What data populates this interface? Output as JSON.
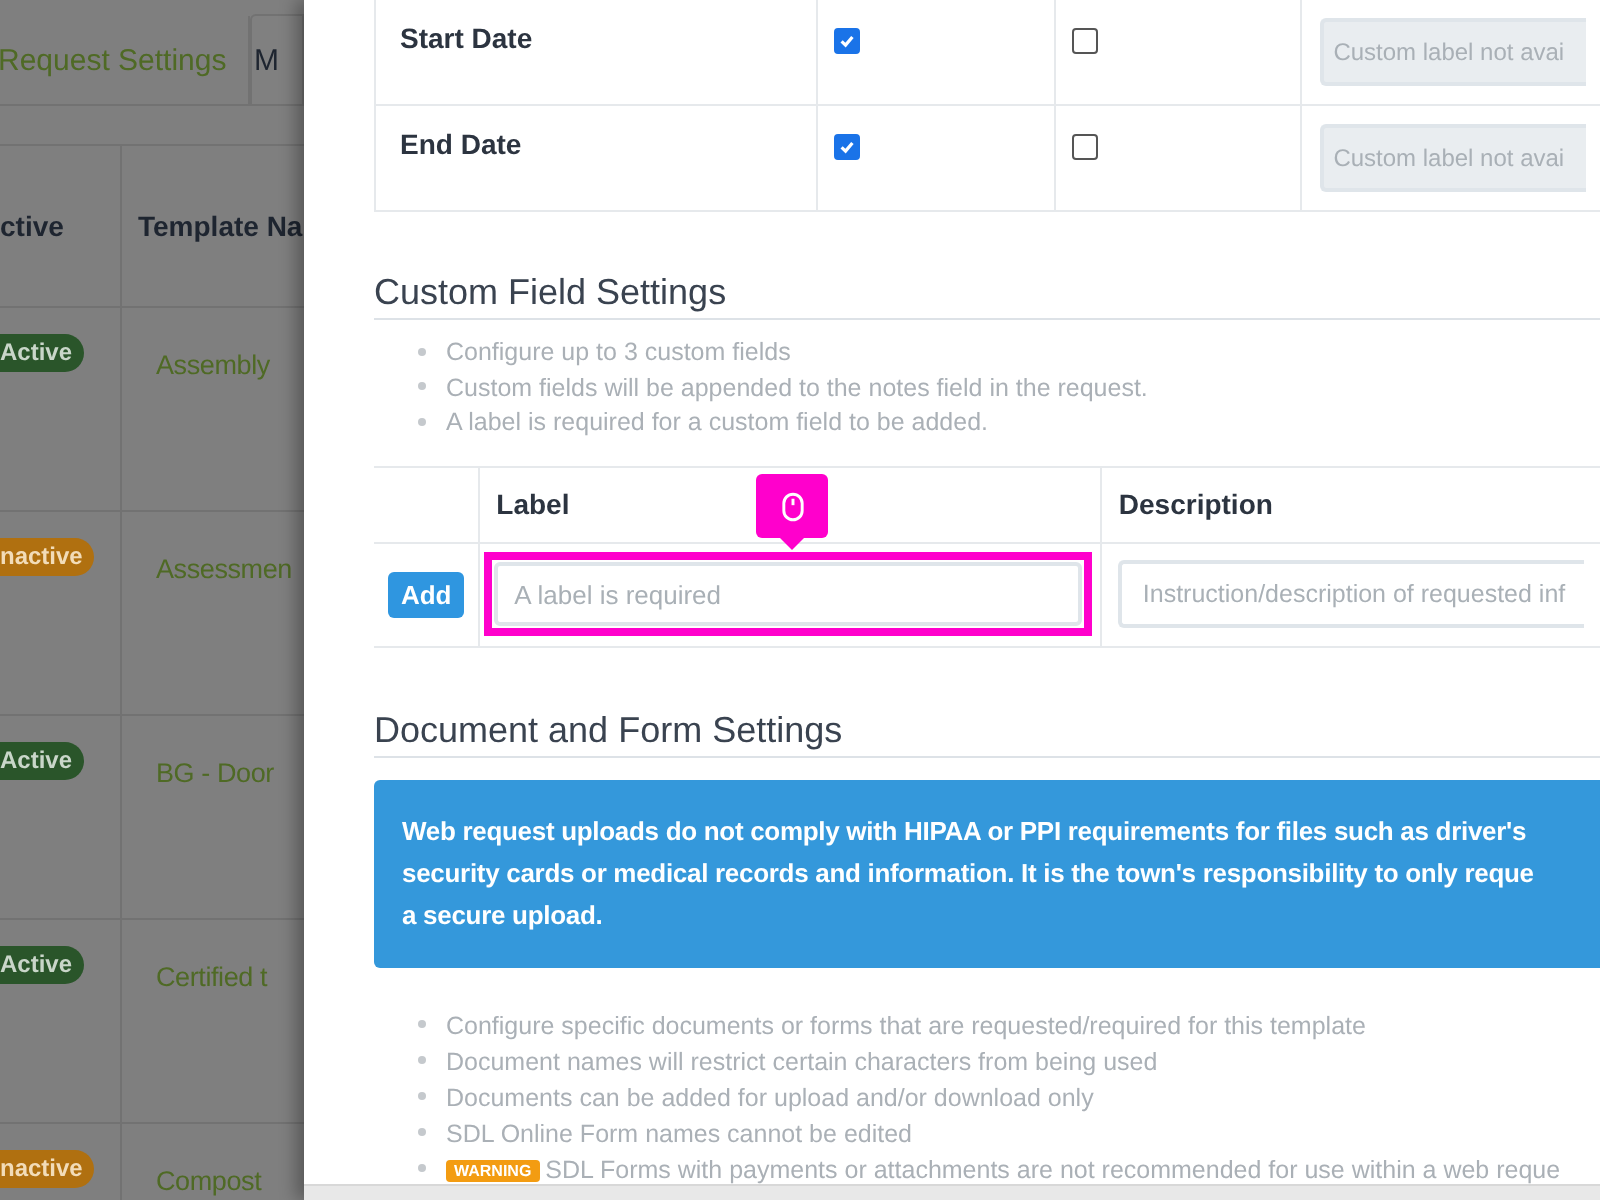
{
  "background_page": {
    "tabs": [
      {
        "label": "Request Settings",
        "selected": false
      },
      {
        "label": "M",
        "selected": true
      }
    ],
    "table": {
      "columns": [
        "ctive",
        "Template Na"
      ],
      "rows": [
        {
          "status": "Active",
          "kind": "active",
          "name": "Assembly"
        },
        {
          "status": "nactive",
          "kind": "inactive",
          "name": "Assessmen"
        },
        {
          "status": "Active",
          "kind": "active",
          "name": "BG - Door"
        },
        {
          "status": "Active",
          "kind": "active",
          "name": "Certified t"
        },
        {
          "status": "nactive",
          "kind": "inactive",
          "name": "Compost"
        }
      ]
    }
  },
  "modal": {
    "fields_table": {
      "rows": [
        {
          "name": "Start Date",
          "required": true,
          "hidden": false,
          "custom_label_placeholder": "Custom label not avai"
        },
        {
          "name": "End Date",
          "required": true,
          "hidden": false,
          "custom_label_placeholder": "Custom label not avai"
        }
      ]
    },
    "custom_field_settings": {
      "heading": "Custom Field Settings",
      "notes": [
        "Configure up to 3 custom fields",
        "Custom fields will be appended to the notes field in the request.",
        "A label is required for a custom field to be added."
      ],
      "table": {
        "columns": [
          "Label",
          "Description"
        ],
        "rows": [
          {
            "button": "Add",
            "label_placeholder": "A label is required",
            "description_placeholder": "Instruction/description of requested inf",
            "highlighted": true
          }
        ]
      }
    },
    "document_settings": {
      "heading": "Document and Form Settings",
      "alert_lines": [
        "Web request uploads do not comply with HIPAA or PPI requirements for files such as driver's",
        "security cards or medical records and information. It is the town's responsibility to only reque",
        "a secure upload."
      ],
      "notes": [
        {
          "text": "Configure specific documents or forms that are requested/required for this template"
        },
        {
          "text": "Document names will restrict certain characters from being used"
        },
        {
          "text": "Documents can be added for upload and/or download only"
        },
        {
          "text": "SDL Online Form names cannot be edited"
        },
        {
          "badge": "WARNING",
          "text": "SDL Forms with payments or attachments are not recommended for use within a web reque"
        }
      ]
    }
  }
}
